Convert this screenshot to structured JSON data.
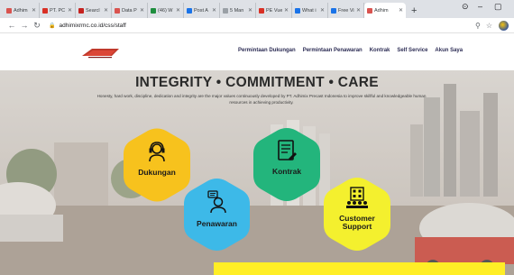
{
  "browser": {
    "tabs": [
      {
        "label": "Adhim",
        "fav": "#d9534f"
      },
      {
        "label": "PT. PC",
        "fav": "#d93025"
      },
      {
        "label": "Searcl",
        "fav": "#c5221f"
      },
      {
        "label": "Data P",
        "fav": "#d9534f"
      },
      {
        "label": "(46) W",
        "fav": "#1e8e3e"
      },
      {
        "label": "Post A",
        "fav": "#1a73e8"
      },
      {
        "label": "5 Man",
        "fav": "#9aa0a6"
      },
      {
        "label": "PE Vue",
        "fav": "#d93025"
      },
      {
        "label": "What i",
        "fav": "#1a73e8"
      },
      {
        "label": "Free Vi",
        "fav": "#1a73e8"
      },
      {
        "label": "Adhim",
        "fav": "#d9534f"
      }
    ],
    "new_tab_symbol": "+",
    "url": "adhimixrmc.co.id/css/staff"
  },
  "site": {
    "nav": [
      "Permintaan Dukungan",
      "Permintaan Penawaran",
      "Kontrak",
      "Self Service",
      "Akun Saya"
    ],
    "headline": "INTEGRITY • COMMITMENT • CARE",
    "subtext": "Honesty, hard work, discipline, dedication and integrity are the major values continuously developed by PT. Adhimix Precast Indonesia to improve skillful and knowledgeable human resources in achieving productivity.",
    "tiles": {
      "dukungan": {
        "label": "Dukungan",
        "color": "#f7c21d",
        "icon": "headset-agent-icon"
      },
      "penawaran": {
        "label": "Penawaran",
        "color": "#3db9e8",
        "icon": "chat-person-icon"
      },
      "kontrak": {
        "label": "Kontrak",
        "color": "#23b57c",
        "icon": "contract-document-icon"
      },
      "support": {
        "label": "Customer Support",
        "label_line1": "Customer",
        "label_line2": "Support",
        "color": "#f4f02e",
        "icon": "building-people-icon"
      }
    }
  },
  "colors": {
    "accent_yellow": "#ffee26",
    "nav_text": "#2c2c54"
  }
}
